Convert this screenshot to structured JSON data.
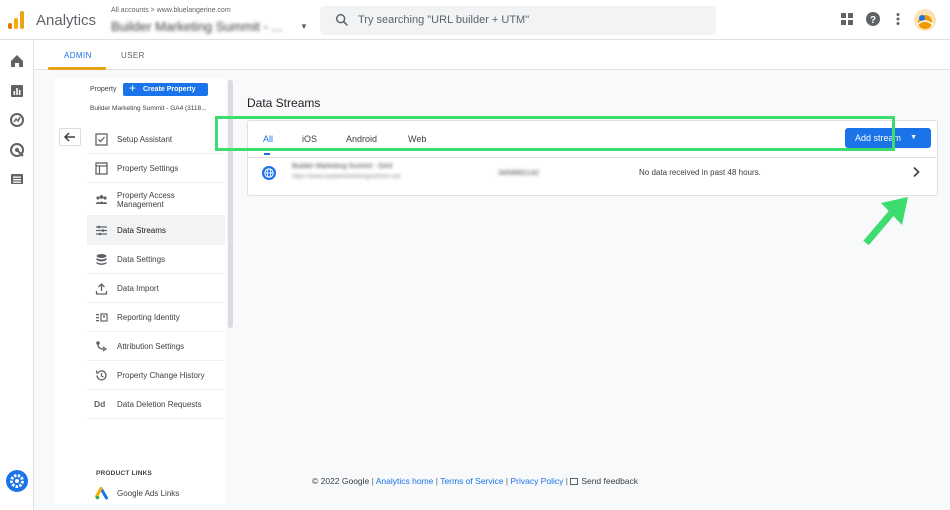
{
  "header": {
    "app_name": "Analytics",
    "account_path": "All accounts > www.bluelangerine.com",
    "property_name": "Builder Marketing Summit - ...",
    "search_placeholder": "Try searching \"URL builder + UTM\""
  },
  "admin_tabs": [
    {
      "label": "ADMIN",
      "active": true
    },
    {
      "label": "USER",
      "active": false
    }
  ],
  "property_panel": {
    "label": "Property",
    "create_button": "Create Property",
    "selected_property": "Builder Marketing Summit - GA4 (3118..."
  },
  "menu_items": [
    {
      "label": "Setup Assistant",
      "icon": "checkbox-icon"
    },
    {
      "label": "Property Settings",
      "icon": "layout-icon"
    },
    {
      "label": "Property Access Management",
      "icon": "people-icon"
    },
    {
      "label": "Data Streams",
      "icon": "streams-icon",
      "active": true
    },
    {
      "label": "Data Settings",
      "icon": "database-icon"
    },
    {
      "label": "Data Import",
      "icon": "upload-icon"
    },
    {
      "label": "Reporting Identity",
      "icon": "identity-icon"
    },
    {
      "label": "Attribution Settings",
      "icon": "attribution-icon"
    },
    {
      "label": "Property Change History",
      "icon": "history-icon"
    },
    {
      "label": "Data Deletion Requests",
      "icon": "dd-icon",
      "glyph": "Dd"
    }
  ],
  "product_links": {
    "heading": "PRODUCT LINKS",
    "items": [
      {
        "label": "Google Ads Links",
        "icon": "google-ads-icon"
      }
    ]
  },
  "data_streams": {
    "title": "Data Streams",
    "filter_tabs": [
      {
        "label": "All",
        "active": true
      },
      {
        "label": "iOS",
        "active": false
      },
      {
        "label": "Android",
        "active": false
      },
      {
        "label": "Web",
        "active": false
      }
    ],
    "add_button": "Add stream",
    "streams": [
      {
        "name": "Builder Marketing Summit - GA4",
        "url": "https://www.builderMarketingsummit.com",
        "id": "3459991142",
        "status": "No data received in past 48 hours."
      }
    ]
  },
  "footer": {
    "copyright": "© 2022 Google",
    "links": [
      "Analytics home",
      "Terms of Service",
      "Privacy Policy"
    ],
    "feedback": "Send feedback"
  },
  "colors": {
    "accent": "#1a73e8",
    "tab_underline": "#e8a317",
    "highlight": "#3ddc6e"
  }
}
